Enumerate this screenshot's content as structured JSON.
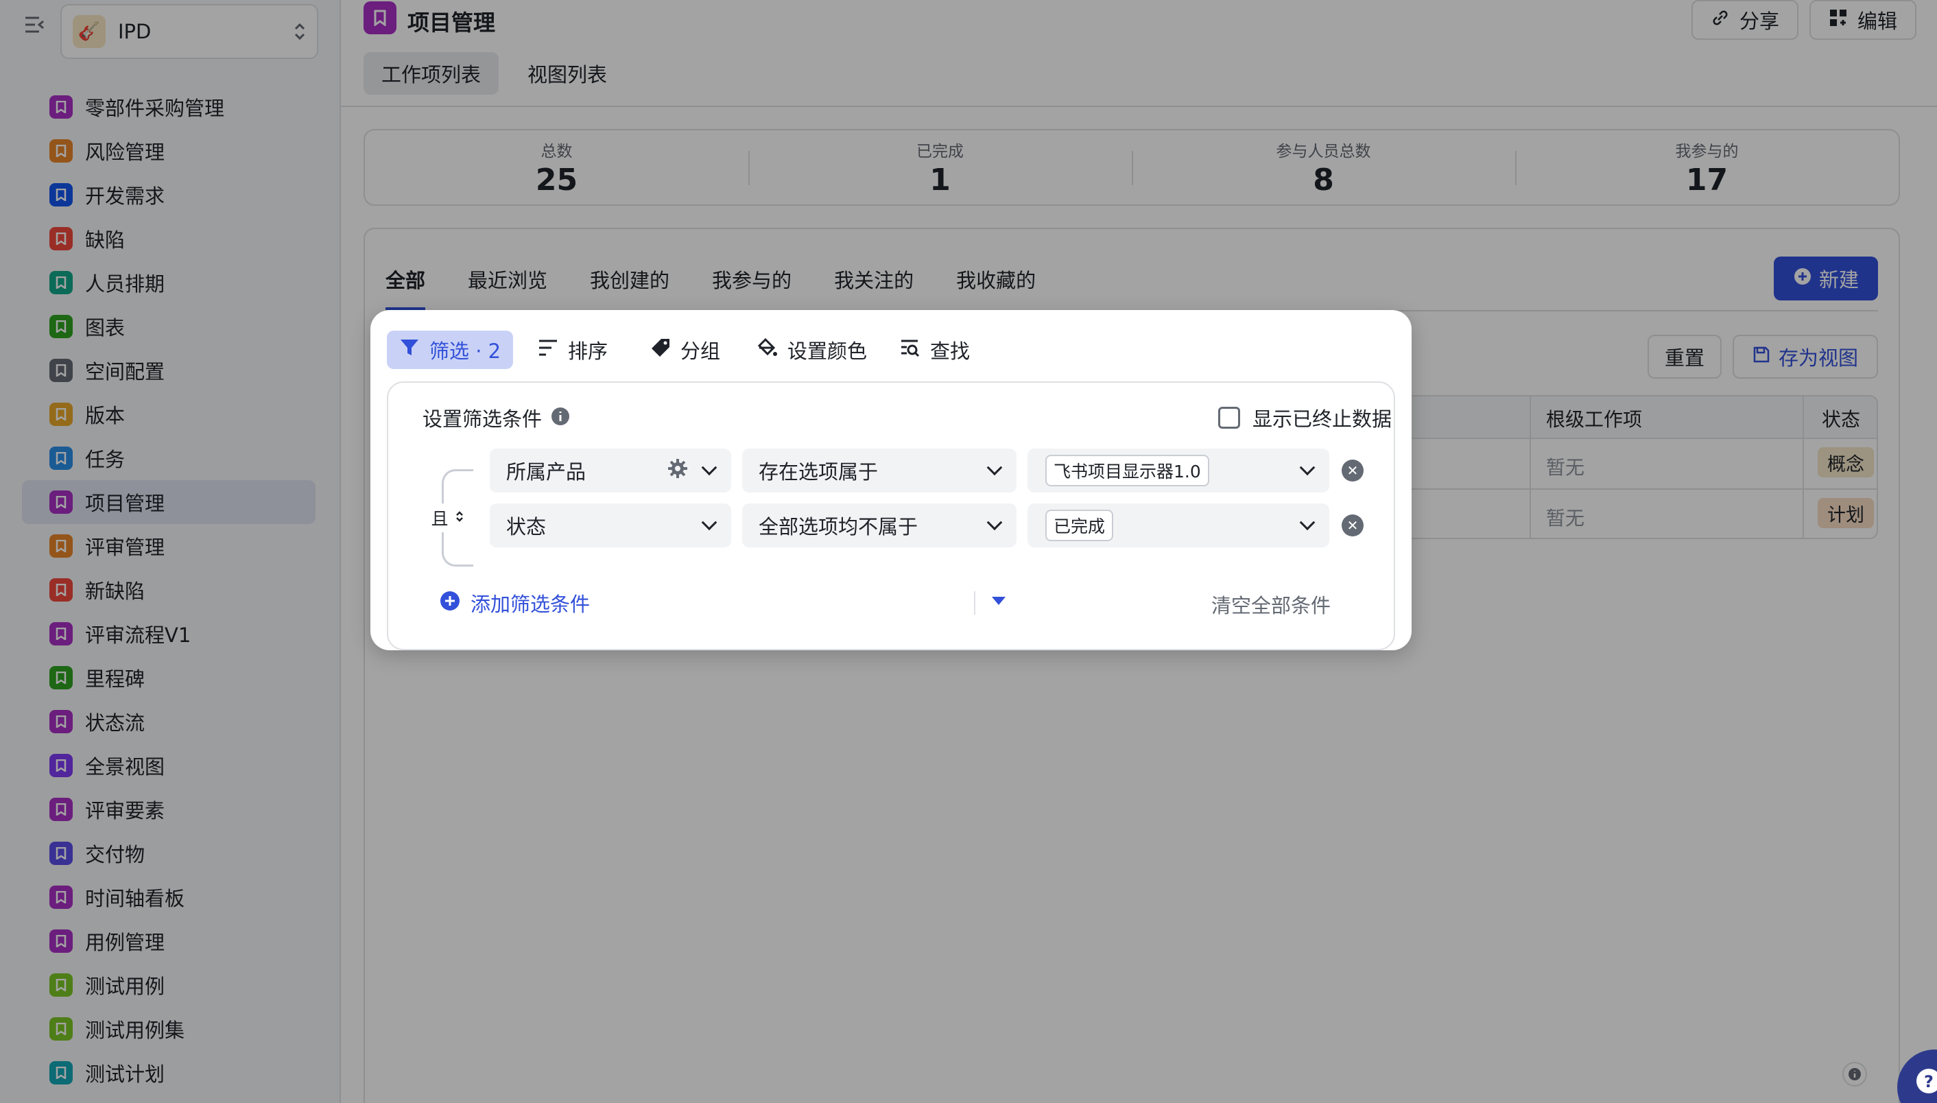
{
  "sidebar": {
    "workspace": "IPD",
    "items": [
      {
        "label": "零部件采购管理",
        "color": "#a830c4",
        "active": false
      },
      {
        "label": "风险管理",
        "color": "#e8862a",
        "active": false
      },
      {
        "label": "开发需求",
        "color": "#1456f0",
        "active": false
      },
      {
        "label": "缺陷",
        "color": "#f0483e",
        "active": false
      },
      {
        "label": "人员排期",
        "color": "#14a88a",
        "active": false
      },
      {
        "label": "图表",
        "color": "#2ea121",
        "active": false
      },
      {
        "label": "空间配置",
        "color": "#646a73",
        "active": false
      },
      {
        "label": "版本",
        "color": "#e8a82a",
        "active": false
      },
      {
        "label": "任务",
        "color": "#2b8fe8",
        "active": false
      },
      {
        "label": "项目管理",
        "color": "#a830c4",
        "active": true
      },
      {
        "label": "评审管理",
        "color": "#e8862a",
        "active": false
      },
      {
        "label": "新缺陷",
        "color": "#f0483e",
        "active": false
      },
      {
        "label": "评审流程V1",
        "color": "#a830c4",
        "active": false
      },
      {
        "label": "里程碑",
        "color": "#2ea121",
        "active": false
      },
      {
        "label": "状态流",
        "color": "#a830c4",
        "active": false
      },
      {
        "label": "全景视图",
        "color": "#7f3bf5",
        "active": false
      },
      {
        "label": "评审要素",
        "color": "#a830c4",
        "active": false
      },
      {
        "label": "交付物",
        "color": "#5b4de8",
        "active": false
      },
      {
        "label": "时间轴看板",
        "color": "#a830c4",
        "active": false
      },
      {
        "label": "用例管理",
        "color": "#a830c4",
        "active": false
      },
      {
        "label": "测试用例",
        "color": "#7bc624",
        "active": false
      },
      {
        "label": "测试用例集",
        "color": "#7bc624",
        "active": false
      },
      {
        "label": "测试计划",
        "color": "#14a8b8",
        "active": false
      }
    ]
  },
  "header": {
    "title": "项目管理",
    "share_label": "分享",
    "edit_label": "编辑",
    "tabs": [
      "工作项列表",
      "视图列表"
    ]
  },
  "stats": [
    {
      "label": "总数",
      "value": "25"
    },
    {
      "label": "已完成",
      "value": "1"
    },
    {
      "label": "参与人员总数",
      "value": "8"
    },
    {
      "label": "我参与的",
      "value": "17"
    }
  ],
  "view_tabs": [
    "全部",
    "最近浏览",
    "我创建的",
    "我参与的",
    "我关注的",
    "我收藏的"
  ],
  "new_label": "新建",
  "reset_label": "重置",
  "save_view_label": "存为视图",
  "table": {
    "col_root": "根级工作项",
    "col_status": "状态",
    "rows": [
      {
        "root": "暂无",
        "status": "概念",
        "status_bg": "#f5e6c8"
      },
      {
        "root": "暂无",
        "status": "计划",
        "status_bg": "#f7dcc4"
      }
    ]
  },
  "filter_popup": {
    "tools": [
      {
        "label": "筛选 · 2",
        "icon": "filter-icon"
      },
      {
        "label": "排序",
        "icon": "sort-icon"
      },
      {
        "label": "分组",
        "icon": "tag-icon"
      },
      {
        "label": "设置颜色",
        "icon": "paint-bucket-icon"
      },
      {
        "label": "查找",
        "icon": "find-icon"
      }
    ],
    "title": "设置筛选条件",
    "show_terminated_label": "显示已终止数据",
    "logic": "且",
    "conditions": [
      {
        "field": "所属产品",
        "operator": "存在选项属于",
        "value": "飞书项目显示器1.0"
      },
      {
        "field": "状态",
        "operator": "全部选项均不属于",
        "value": "已完成"
      }
    ],
    "add_label": "添加筛选条件",
    "clear_label": "清空全部条件"
  }
}
